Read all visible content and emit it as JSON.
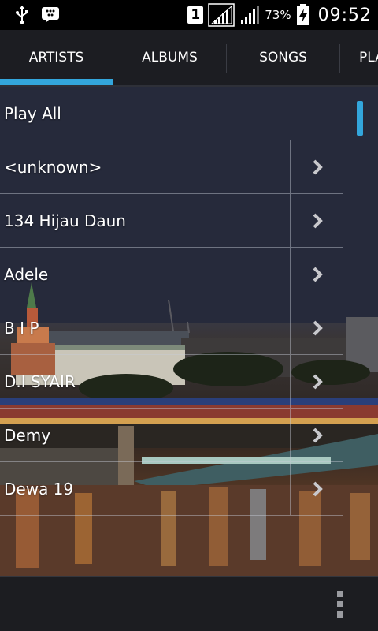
{
  "status_bar": {
    "icons_left": [
      "usb-icon",
      "bbm-icon"
    ],
    "sim_slot": "1",
    "battery_percent": "73%",
    "time": "09:52"
  },
  "tabs": [
    {
      "label": "ARTISTS",
      "selected": true
    },
    {
      "label": "ALBUMS",
      "selected": false
    },
    {
      "label": "SONGS",
      "selected": false
    },
    {
      "label": "PLA",
      "selected": false
    }
  ],
  "list": {
    "play_all": "Play All",
    "artists": [
      "<unknown>",
      "134 Hijau Daun",
      "Adele",
      "B I P",
      "D.I SYAIR",
      "Demy",
      "Dewa 19"
    ]
  },
  "bottom_bar": {
    "menu_icon": "overflow-menu-icon"
  },
  "colors": {
    "accent": "#33a6dc",
    "tab_bar": "#1c1d22",
    "status_bar": "#000000"
  }
}
